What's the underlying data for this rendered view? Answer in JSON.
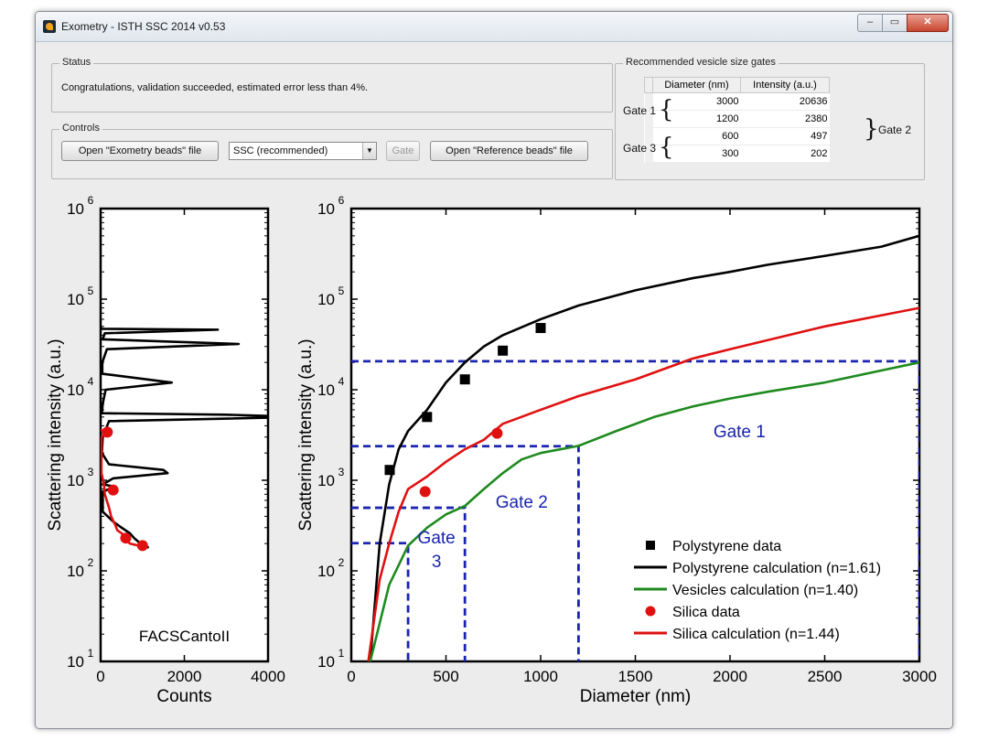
{
  "window": {
    "title": "Exometry - ISTH SSC 2014 v0.53",
    "min": "▭",
    "max": "▭",
    "close": "✕"
  },
  "status": {
    "label": "Status",
    "text": "Congratulations, validation succeeded, estimated error less than 4%."
  },
  "controls": {
    "label": "Controls",
    "open_exometry": "Open \"Exometry beads\" file",
    "select_value": "SSC (recommended)",
    "gate": "Gate",
    "open_reference": "Open \"Reference beads\" file"
  },
  "gates_panel": {
    "label": "Recommended vesicle size gates",
    "headers": [
      "Diameter (nm)",
      "Intensity (a.u.)"
    ],
    "rows": [
      [
        "3000",
        "20636"
      ],
      [
        "1200",
        "2380"
      ],
      [
        "600",
        "497"
      ],
      [
        "300",
        "202"
      ]
    ],
    "gate1": "Gate 1",
    "gate2": "Gate 2",
    "gate3": "Gate 3"
  },
  "chart_data": [
    {
      "type": "line",
      "title": "",
      "xlabel": "Counts",
      "ylabel": "Scattering intensity (a.u.)",
      "xlim": [
        0,
        4000
      ],
      "ylim": [
        10,
        1000000
      ],
      "ylog": true,
      "xticks": [
        "0",
        "2000",
        "4000"
      ],
      "yticks": [
        "10",
        "10",
        "10",
        "10",
        "10",
        "10"
      ],
      "ytick_exps": [
        "1",
        "2",
        "3",
        "4",
        "5",
        "6"
      ],
      "annotation": "FACSCantoII",
      "series": [
        {
          "color": "#000000",
          "points": [
            [
              0,
              50000
            ],
            [
              20,
              47000
            ],
            [
              2800,
              46000
            ],
            [
              100,
              42000
            ],
            [
              50,
              36000
            ],
            [
              3300,
              32000
            ],
            [
              150,
              28000
            ],
            [
              40,
              20000
            ],
            [
              40,
              15000
            ],
            [
              1700,
              12000
            ],
            [
              120,
              10000
            ],
            [
              50,
              7000
            ],
            [
              30,
              5500
            ],
            [
              3000,
              5300
            ],
            [
              4800,
              5000
            ],
            [
              200,
              4500
            ],
            [
              50,
              3000
            ],
            [
              30,
              2000
            ],
            [
              200,
              1500
            ],
            [
              1500,
              1300
            ],
            [
              1600,
              1200
            ],
            [
              300,
              1050
            ],
            [
              50,
              900
            ],
            [
              350,
              850
            ],
            [
              50,
              750
            ],
            [
              50,
              600
            ],
            [
              50,
              450
            ],
            [
              300,
              350
            ],
            [
              500,
              300
            ],
            [
              700,
              260
            ],
            [
              800,
              230
            ],
            [
              900,
              210
            ],
            [
              1000,
              195
            ],
            [
              1100,
              185
            ],
            [
              1150,
              180
            ]
          ]
        },
        {
          "color": "#e01010",
          "points": [
            [
              0,
              3600
            ],
            [
              150,
              3300
            ],
            [
              20,
              3000
            ],
            [
              20,
              1200
            ],
            [
              80,
              900
            ],
            [
              100,
              700
            ],
            [
              200,
              500
            ],
            [
              250,
              400
            ],
            [
              350,
              320
            ],
            [
              400,
              280
            ],
            [
              550,
              250
            ],
            [
              600,
              220
            ],
            [
              700,
              200
            ],
            [
              900,
              190
            ],
            [
              1100,
              185
            ]
          ]
        }
      ],
      "markers": [
        {
          "color": "#e01010",
          "points": [
            [
              160,
              3400
            ],
            [
              300,
              780
            ],
            [
              1000,
              190
            ],
            [
              600,
              230
            ]
          ]
        }
      ]
    },
    {
      "type": "line",
      "title": "",
      "xlabel": "Diameter (nm)",
      "ylabel": "Scattering intensity (a.u.)",
      "xlim": [
        0,
        3000
      ],
      "ylim": [
        10,
        1000000
      ],
      "ylog": true,
      "xticks": [
        "0",
        "500",
        "1000",
        "1500",
        "2000",
        "2500",
        "3000"
      ],
      "yticks": [
        "10",
        "10",
        "10",
        "10",
        "10",
        "10"
      ],
      "ytick_exps": [
        "1",
        "2",
        "3",
        "4",
        "5",
        "6"
      ],
      "series": [
        {
          "name": "Polystyrene calculation (n=1.61)",
          "color": "#000000",
          "points": [
            [
              100,
              10
            ],
            [
              150,
              200
            ],
            [
              200,
              900
            ],
            [
              250,
              2200
            ],
            [
              300,
              3500
            ],
            [
              400,
              6000
            ],
            [
              500,
              12000
            ],
            [
              600,
              20000
            ],
            [
              700,
              30000
            ],
            [
              800,
              40000
            ],
            [
              1000,
              60000
            ],
            [
              1200,
              85000
            ],
            [
              1500,
              125000
            ],
            [
              1800,
              170000
            ],
            [
              2000,
              200000
            ],
            [
              2200,
              240000
            ],
            [
              2500,
              300000
            ],
            [
              2800,
              380000
            ],
            [
              3000,
              500000
            ]
          ]
        },
        {
          "name": "Silica calculation (n=1.44)",
          "color": "#e01010",
          "points": [
            [
              90,
              10
            ],
            [
              150,
              80
            ],
            [
              200,
              200
            ],
            [
              250,
              450
            ],
            [
              300,
              800
            ],
            [
              400,
              1100
            ],
            [
              500,
              1600
            ],
            [
              600,
              2200
            ],
            [
              700,
              2800
            ],
            [
              800,
              4200
            ],
            [
              1000,
              6000
            ],
            [
              1200,
              8500
            ],
            [
              1500,
              13000
            ],
            [
              1800,
              22000
            ],
            [
              2000,
              28000
            ],
            [
              2500,
              50000
            ],
            [
              3000,
              80000
            ]
          ]
        },
        {
          "name": "Vesicles calculation (n=1.40)",
          "color": "#1e8a1e",
          "points": [
            [
              100,
              10
            ],
            [
              200,
              70
            ],
            [
              300,
              190
            ],
            [
              400,
              300
            ],
            [
              500,
              420
            ],
            [
              600,
              520
            ],
            [
              700,
              800
            ],
            [
              800,
              1200
            ],
            [
              900,
              1700
            ],
            [
              1000,
              2000
            ],
            [
              1200,
              2400
            ],
            [
              1400,
              3500
            ],
            [
              1600,
              5000
            ],
            [
              1800,
              6500
            ],
            [
              2000,
              8000
            ],
            [
              2200,
              9500
            ],
            [
              2500,
              12000
            ],
            [
              3000,
              20000
            ]
          ]
        }
      ],
      "markers": [
        {
          "name": "Polystyrene data",
          "shape": "square",
          "color": "#000000",
          "points": [
            [
              203,
              1300
            ],
            [
              400,
              5000
            ],
            [
              600,
              13000
            ],
            [
              800,
              27000
            ],
            [
              1000,
              48000
            ]
          ]
        },
        {
          "name": "Silica data",
          "shape": "circle",
          "color": "#e01010",
          "points": [
            [
              390,
              750
            ],
            [
              770,
              3300
            ]
          ]
        }
      ],
      "gates": [
        {
          "x": 3000,
          "y": 20636
        },
        {
          "x": 1200,
          "y": 2380
        },
        {
          "x": 600,
          "y": 497
        },
        {
          "x": 300,
          "y": 202
        }
      ],
      "gate_labels": [
        {
          "text": "Gate 1",
          "x": 2050,
          "y": 3000
        },
        {
          "text": "Gate 2",
          "x": 900,
          "y": 500
        },
        {
          "text": "Gate",
          "x": 450,
          "y": 200
        },
        {
          "text": "3",
          "x": 450,
          "y": 110
        }
      ],
      "legend": {
        "position": "bottom-right",
        "entries": [
          {
            "label": "Polystyrene data",
            "kind": "square",
            "color": "#000000"
          },
          {
            "label": "Polystyrene calculation (n=1.61)",
            "kind": "line",
            "color": "#000000"
          },
          {
            "label": "Vesicles calculation (n=1.40)",
            "kind": "line",
            "color": "#1e8a1e"
          },
          {
            "label": "Silica data",
            "kind": "circle",
            "color": "#e01010"
          },
          {
            "label": "Silica calculation (n=1.44)",
            "kind": "line",
            "color": "#e01010"
          }
        ]
      }
    }
  ]
}
